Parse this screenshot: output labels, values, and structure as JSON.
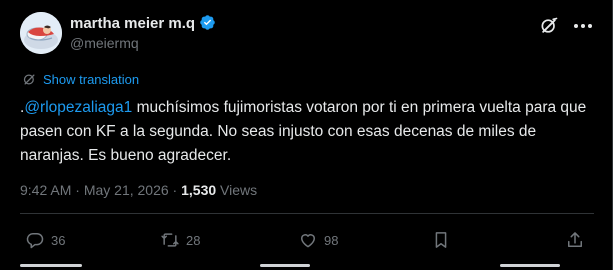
{
  "author": {
    "display_name": "martha meier m.q",
    "handle": "@meiermq"
  },
  "translate_label": "Show translation",
  "tweet": {
    "prefix": ".",
    "mention": "@rlopezaliaga1",
    "body": " muchísimos fujimoristas votaron por ti en primera vuelta para que pasen con KF a la segunda. No seas injusto con esas decenas de miles de naranjas. Es bueno agradecer."
  },
  "meta": {
    "time": "9:42 AM",
    "separator": " · ",
    "date": "May 21, 2026",
    "views_count": "1,530",
    "views_label": " Views"
  },
  "actions": {
    "replies": "36",
    "reposts": "28",
    "likes": "98"
  },
  "icons": {
    "verified": "verified-badge-icon",
    "grok": "grok-icon",
    "more": "more-icon",
    "translate": "translate-icon",
    "reply": "reply-icon",
    "repost": "repost-icon",
    "like": "heart-icon",
    "bookmark": "bookmark-icon",
    "share": "share-icon"
  },
  "colors": {
    "background": "#000000",
    "text": "#e7e9ea",
    "secondary": "#71767b",
    "accent": "#1d9bf0",
    "divider": "#2f3336"
  }
}
